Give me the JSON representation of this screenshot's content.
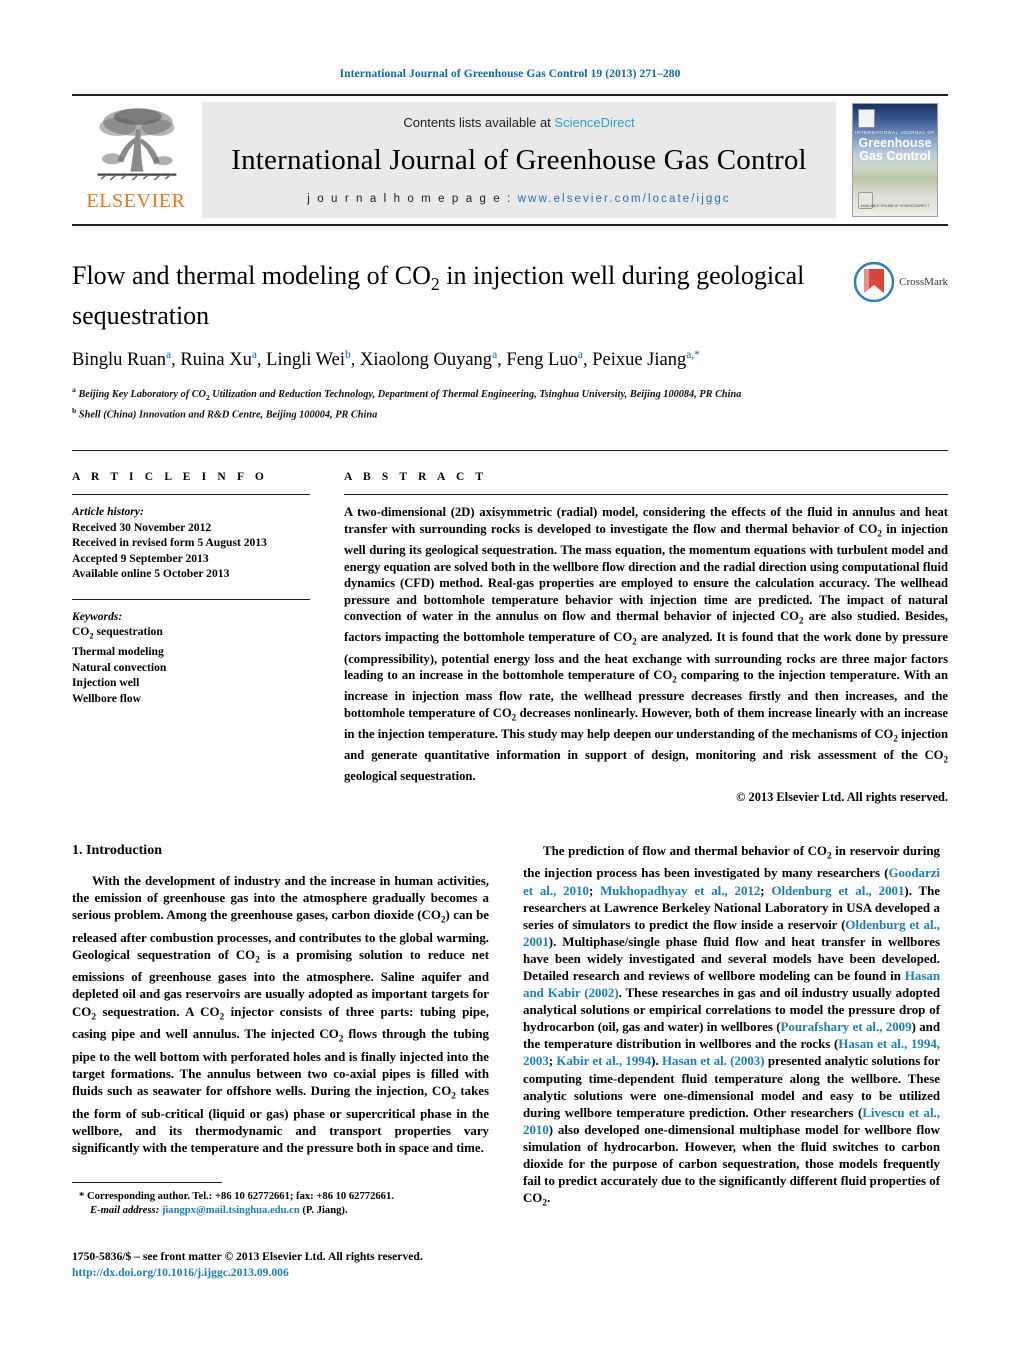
{
  "running_head": "International Journal of Greenhouse Gas Control 19 (2013) 271–280",
  "masthead": {
    "contents_prefix": "Contents lists available at ",
    "sciencedirect": "ScienceDirect",
    "journal_title": "International Journal of Greenhouse Gas Control",
    "homepage_prefix": "j o u r n a l   h o m e p a g e :  ",
    "homepage_url": "www.elsevier.com/locate/ijggc",
    "publisher": "ELSEVIER",
    "publisher_logo": "elsevier-tree-logo",
    "cover": {
      "kicker": "INTERNATIONAL JOURNAL OF",
      "line1": "Greenhouse",
      "line2": "Gas Control",
      "footer": "AVAILABLE ONLINE AT SCIENCEDIRECT"
    },
    "accent_blue": "#2a9fd0",
    "link_blue": "#2a6fb0",
    "elsevier_orange": "#e87722"
  },
  "article": {
    "title_part1": "Flow and thermal modeling of CO",
    "title_sub": "2",
    "title_part2": " in injection well during geological sequestration",
    "crossmark_label": "CrossMark",
    "authors_html": "Binglu Ruan<sup>a</sup>, Ruina Xu<sup>a</sup>, Lingli Wei<sup>b</sup>, Xiaolong Ouyang<sup>a</sup>, Feng Luo<sup>a</sup>, Peixue Jiang<sup>a,*</sup>",
    "affiliation_a": "Beijing Key Laboratory of CO2 Utilization and Reduction Technology, Department of Thermal Engineering, Tsinghua University, Beijing 100084, PR China",
    "affiliation_b": "Shell (China) Innovation and R&D Centre, Beijing 100004, PR China"
  },
  "article_info": {
    "label": "A R T I C L E  I N F O",
    "history_header": "Article history:",
    "history": [
      "Received 30 November 2012",
      "Received in revised form 5 August 2013",
      "Accepted 9 September 2013",
      "Available online 5 October 2013"
    ],
    "keywords_header": "Keywords:",
    "keywords": [
      "CO2 sequestration",
      "Thermal modeling",
      "Natural convection",
      "Injection well",
      "Wellbore flow"
    ]
  },
  "abstract": {
    "label": "A B S T R A C T",
    "text": "A two-dimensional (2D) axisymmetric (radial) model, considering the effects of the fluid in annulus and heat transfer with surrounding rocks is developed to investigate the flow and thermal behavior of CO2 in injection well during its geological sequestration. The mass equation, the momentum equations with turbulent model and energy equation are solved both in the wellbore flow direction and the radial direction using computational fluid dynamics (CFD) method. Real-gas properties are employed to ensure the calculation accuracy. The wellhead pressure and bottomhole temperature behavior with injection time are predicted. The impact of natural convection of water in the annulus on flow and thermal behavior of injected CO2 are also studied. Besides, factors impacting the bottomhole temperature of CO2 are analyzed. It is found that the work done by pressure (compressibility), potential energy loss and the heat exchange with surrounding rocks are three major factors leading to an increase in the bottomhole temperature of CO2 comparing to the injection temperature. With an increase in injection mass flow rate, the wellhead pressure decreases firstly and then increases, and the bottomhole temperature of CO2 decreases nonlinearly. However, both of them increase linearly with an increase in the injection temperature. This study may help deepen our understanding of the mechanisms of CO2 injection and generate quantitative information in support of design, monitoring and risk assessment of the CO2 geological sequestration.",
    "copyright": "© 2013 Elsevier Ltd. All rights reserved."
  },
  "body": {
    "section_heading": "1.  Introduction",
    "left_paragraph": "With the development of industry and the increase in human activities, the emission of greenhouse gas into the atmosphere gradually becomes a serious problem. Among the greenhouse gases, carbon dioxide (CO2) can be released after combustion processes, and contributes to the global warming. Geological sequestration of CO2 is a promising solution to reduce net emissions of greenhouse gases into the atmosphere. Saline aquifer and depleted oil and gas reservoirs are usually adopted as important targets for CO2 sequestration. A CO2 injector consists of three parts: tubing pipe, casing pipe and well annulus. The injected CO2 flows through the tubing pipe to the well bottom with perforated holes and is finally injected into the target formations. The annulus between two co-axial pipes is filled with fluids such as seawater for offshore wells. During the injection, CO2 takes the form of sub-critical (liquid or gas) phase or supercritical phase in the wellbore, and its thermodynamic and transport properties vary significantly with the temperature and the pressure both in space and time.",
    "right_paragraph": "The prediction of flow and thermal behavior of CO2 in reservoir during the injection process has been investigated by many researchers (Goodarzi et al., 2010; Mukhopadhyay et al., 2012; Oldenburg et al., 2001). The researchers at Lawrence Berkeley National Laboratory in USA developed a series of simulators to predict the flow inside a reservoir (Oldenburg et al., 2001). Multiphase/single phase fluid flow and heat transfer in wellbores have been widely investigated and several models have been developed. Detailed research and reviews of wellbore modeling can be found in Hasan and Kabir (2002). These researches in gas and oil industry usually adopted analytical solutions or empirical correlations to model the pressure drop of hydrocarbon (oil, gas and water) in wellbores (Pourafshary et al., 2009) and the temperature distribution in wellbores and the rocks (Hasan et al., 1994, 2003; Kabir et al., 1994). Hasan et al. (2003) presented analytic solutions for computing time-dependent fluid temperature along the wellbore. These analytic solutions were one-dimensional model and easy to be utilized during wellbore temperature prediction. Other researchers (Livescu et al., 2010) also developed one-dimensional multiphase model for wellbore flow simulation of hydrocarbon. However, when the fluid switches to carbon dioxide for the purpose of carbon sequestration, those models frequently fail to predict accurately due to the significantly different fluid properties of CO2."
  },
  "footnotes": {
    "corresponding": "* Corresponding author. Tel.: +86 10 62772661; fax: +86 10 62772661.",
    "email_label": "E-mail address:",
    "email": "jiangpx@mail.tsinghua.edu.cn",
    "email_suffix": " (P. Jiang).",
    "issn_line": "1750-5836/$ – see front matter © 2013 Elsevier Ltd. All rights reserved.",
    "doi": "http://dx.doi.org/10.1016/j.ijggc.2013.09.006"
  }
}
